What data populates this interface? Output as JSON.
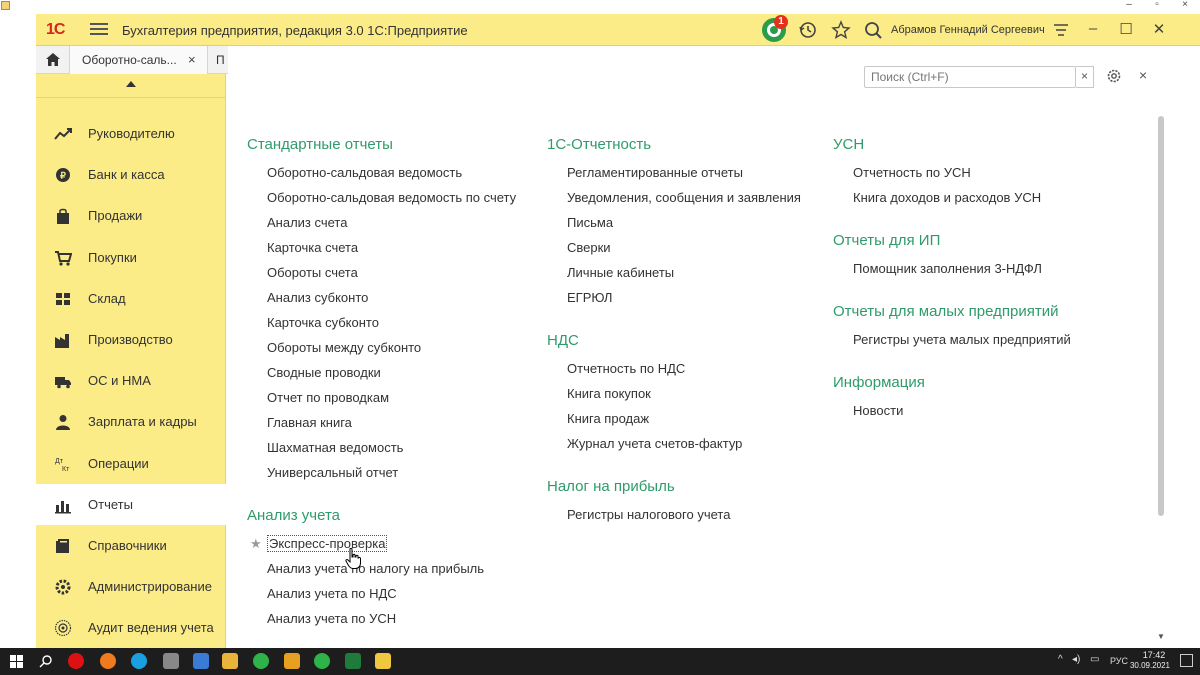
{
  "app": {
    "logo": "1С",
    "title": "Бухгалтерия предприятия, редакция 3.0 1С:Предприятие",
    "user": "Абрамов Геннадий Сергеевич",
    "notification_count": "1"
  },
  "tabs": [
    {
      "label": "Оборотно-саль...",
      "close": "×"
    },
    {
      "label": "П"
    }
  ],
  "sidebar": {
    "items": [
      {
        "label": "Руководителю",
        "icon": "chart-trend-icon"
      },
      {
        "label": "Банк и касса",
        "icon": "coin-icon"
      },
      {
        "label": "Продажи",
        "icon": "shopping-bag-icon"
      },
      {
        "label": "Покупки",
        "icon": "cart-icon"
      },
      {
        "label": "Склад",
        "icon": "warehouse-icon"
      },
      {
        "label": "Производство",
        "icon": "factory-icon"
      },
      {
        "label": "ОС и НМА",
        "icon": "truck-icon"
      },
      {
        "label": "Зарплата и кадры",
        "icon": "person-icon"
      },
      {
        "label": "Операции",
        "icon": "dt-kt-icon"
      },
      {
        "label": "Отчеты",
        "icon": "bar-chart-icon",
        "active": true
      },
      {
        "label": "Справочники",
        "icon": "book-icon"
      },
      {
        "label": "Администрирование",
        "icon": "gear-icon"
      },
      {
        "label": "Аудит ведения учета",
        "icon": "audit-icon"
      }
    ]
  },
  "search": {
    "placeholder": "Поиск (Ctrl+F)",
    "clear": "×"
  },
  "panel_close": "×",
  "col1": {
    "standard": {
      "title": "Стандартные отчеты",
      "items": [
        "Оборотно-сальдовая ведомость",
        "Оборотно-сальдовая ведомость по счету",
        "Анализ счета",
        "Карточка счета",
        "Обороты счета",
        "Анализ субконто",
        "Карточка субконто",
        "Обороты между субконто",
        "Сводные проводки",
        "Отчет по проводкам",
        "Главная книга",
        "Шахматная ведомость",
        "Универсальный отчет"
      ]
    },
    "analysis": {
      "title": "Анализ учета",
      "items": [
        "Экспресс-проверка",
        "Анализ учета по налогу на прибыль",
        "Анализ учета по НДС",
        "Анализ учета по УСН"
      ]
    }
  },
  "col2": {
    "reporting": {
      "title": "1С-Отчетность",
      "items": [
        "Регламентированные отчеты",
        "Уведомления, сообщения и заявления",
        "Письма",
        "Сверки",
        "Личные кабинеты",
        "ЕГРЮЛ"
      ]
    },
    "vat": {
      "title": "НДС",
      "items": [
        "Отчетность по НДС",
        "Книга покупок",
        "Книга продаж",
        "Журнал учета счетов-фактур"
      ]
    },
    "profit": {
      "title": "Налог на прибыль",
      "items": [
        "Регистры налогового учета"
      ]
    }
  },
  "col3": {
    "usn": {
      "title": "УСН",
      "items": [
        "Отчетность по УСН",
        "Книга доходов и расходов УСН"
      ]
    },
    "ip": {
      "title": "Отчеты для ИП",
      "items": [
        "Помощник заполнения 3-НДФЛ"
      ]
    },
    "small": {
      "title": "Отчеты для малых предприятий",
      "items": [
        "Регистры учета малых предприятий"
      ]
    },
    "info": {
      "title": "Информация",
      "items": [
        "Новости"
      ]
    }
  },
  "taskbar": {
    "lang": "РУС",
    "time": "17:42",
    "date": "30.09.2021"
  },
  "colors": {
    "accent_yellow": "#fbec88",
    "section_green": "#2f9b6a",
    "logo_red": "#d9261c"
  }
}
